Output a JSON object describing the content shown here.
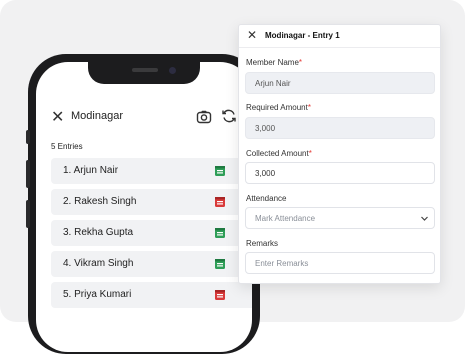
{
  "phone": {
    "title": "Modinagar",
    "entries_count": "5 Entries",
    "entries": [
      {
        "name": "1. Arjun Nair",
        "status": "green"
      },
      {
        "name": "2. Rakesh Singh",
        "status": "red"
      },
      {
        "name": "3. Rekha Gupta",
        "status": "green"
      },
      {
        "name": "4. Vikram Singh",
        "status": "green"
      },
      {
        "name": "5. Priya Kumari",
        "status": "red"
      }
    ]
  },
  "panel": {
    "title": "Modinagar - Entry 1",
    "member_name": {
      "label": "Member Name",
      "value": "Arjun Nair"
    },
    "required_amount": {
      "label": "Required Amount",
      "value": "3,000"
    },
    "collected_amount": {
      "label": "Collected Amount",
      "value": "3,000"
    },
    "attendance": {
      "label": "Attendance",
      "placeholder": "Mark Attendance"
    },
    "remarks": {
      "label": "Remarks",
      "placeholder": "Enter Remarks"
    },
    "required_marker": "*"
  },
  "colors": {
    "status_green": "#2e9e57",
    "status_red": "#d93a3a",
    "required": "#e53935"
  }
}
